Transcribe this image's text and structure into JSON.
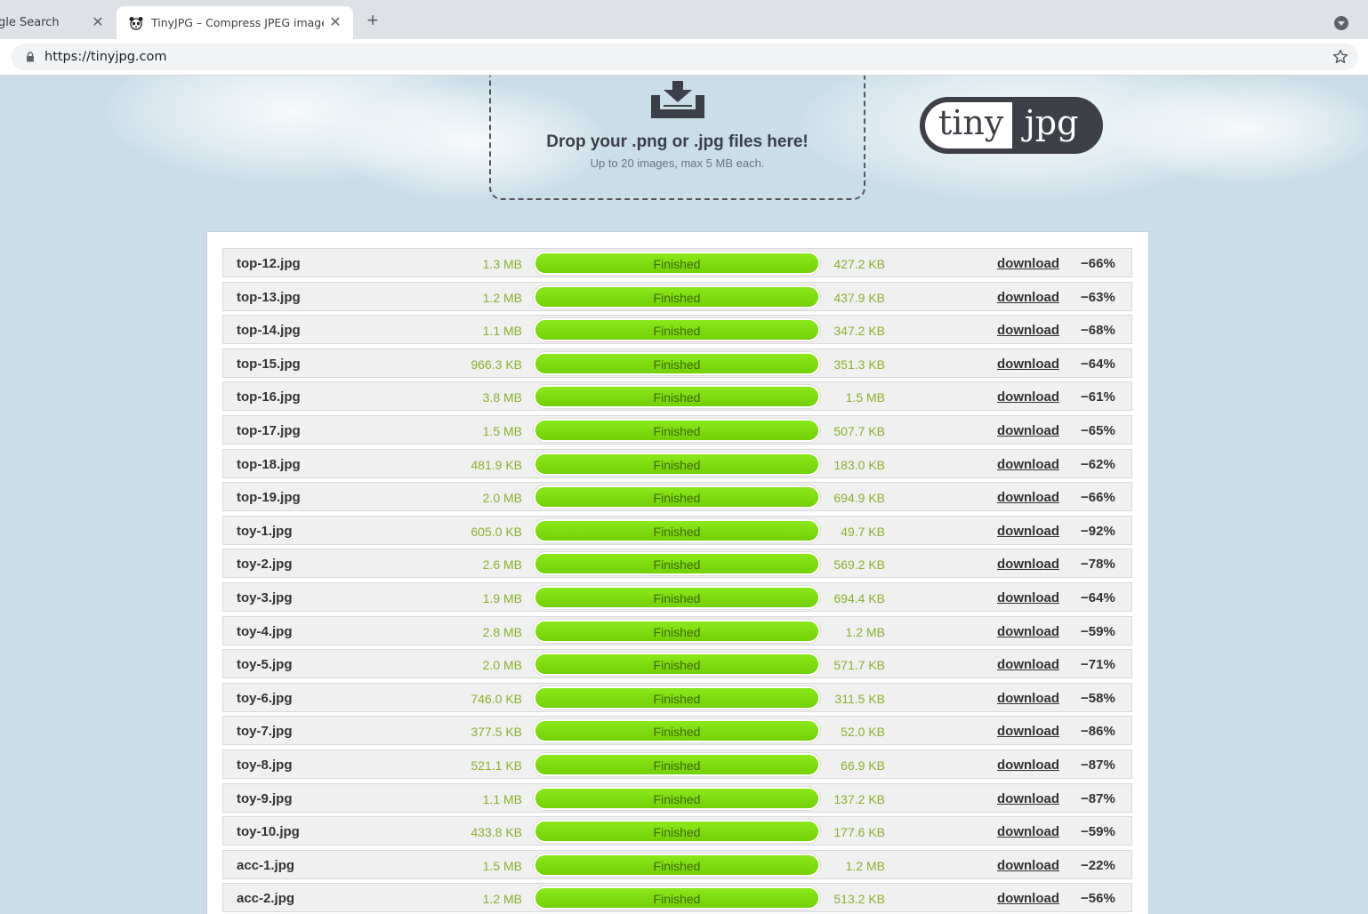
{
  "browser": {
    "tabs": [
      {
        "title": "gle Search"
      },
      {
        "title": "TinyJPG – Compress JPEG images"
      }
    ],
    "url": "https://tinyjpg.com"
  },
  "dropzone": {
    "title": "Drop your .png or .jpg files here!",
    "subtitle": "Up to 20 images, max 5 MB each."
  },
  "logo": {
    "left": "tiny",
    "right": "jpg"
  },
  "colors": {
    "progress": "#7ed90f",
    "size_text": "#8ab02a",
    "background": "#c9dee7"
  },
  "files": [
    {
      "name": "top-12.jpg",
      "original": "1.3 MB",
      "status": "Finished",
      "progress": 100,
      "compressed": "427.2 KB",
      "action": "download",
      "saving": "−66%"
    },
    {
      "name": "top-13.jpg",
      "original": "1.2 MB",
      "status": "Finished",
      "progress": 100,
      "compressed": "437.9 KB",
      "action": "download",
      "saving": "−63%"
    },
    {
      "name": "top-14.jpg",
      "original": "1.1 MB",
      "status": "Finished",
      "progress": 100,
      "compressed": "347.2 KB",
      "action": "download",
      "saving": "−68%"
    },
    {
      "name": "top-15.jpg",
      "original": "966.3 KB",
      "status": "Finished",
      "progress": 100,
      "compressed": "351.3 KB",
      "action": "download",
      "saving": "−64%"
    },
    {
      "name": "top-16.jpg",
      "original": "3.8 MB",
      "status": "Finished",
      "progress": 100,
      "compressed": "1.5 MB",
      "action": "download",
      "saving": "−61%"
    },
    {
      "name": "top-17.jpg",
      "original": "1.5 MB",
      "status": "Finished",
      "progress": 100,
      "compressed": "507.7 KB",
      "action": "download",
      "saving": "−65%"
    },
    {
      "name": "top-18.jpg",
      "original": "481.9 KB",
      "status": "Finished",
      "progress": 100,
      "compressed": "183.0 KB",
      "action": "download",
      "saving": "−62%"
    },
    {
      "name": "top-19.jpg",
      "original": "2.0 MB",
      "status": "Finished",
      "progress": 100,
      "compressed": "694.9 KB",
      "action": "download",
      "saving": "−66%"
    },
    {
      "name": "toy-1.jpg",
      "original": "605.0 KB",
      "status": "Finished",
      "progress": 100,
      "compressed": "49.7 KB",
      "action": "download",
      "saving": "−92%"
    },
    {
      "name": "toy-2.jpg",
      "original": "2.6 MB",
      "status": "Finished",
      "progress": 100,
      "compressed": "569.2 KB",
      "action": "download",
      "saving": "−78%"
    },
    {
      "name": "toy-3.jpg",
      "original": "1.9 MB",
      "status": "Finished",
      "progress": 100,
      "compressed": "694.4 KB",
      "action": "download",
      "saving": "−64%"
    },
    {
      "name": "toy-4.jpg",
      "original": "2.8 MB",
      "status": "Finished",
      "progress": 100,
      "compressed": "1.2 MB",
      "action": "download",
      "saving": "−59%"
    },
    {
      "name": "toy-5.jpg",
      "original": "2.0 MB",
      "status": "Finished",
      "progress": 100,
      "compressed": "571.7 KB",
      "action": "download",
      "saving": "−71%"
    },
    {
      "name": "toy-6.jpg",
      "original": "746.0 KB",
      "status": "Finished",
      "progress": 100,
      "compressed": "311.5 KB",
      "action": "download",
      "saving": "−58%"
    },
    {
      "name": "toy-7.jpg",
      "original": "377.5 KB",
      "status": "Finished",
      "progress": 100,
      "compressed": "52.0 KB",
      "action": "download",
      "saving": "−86%"
    },
    {
      "name": "toy-8.jpg",
      "original": "521.1 KB",
      "status": "Finished",
      "progress": 100,
      "compressed": "66.9 KB",
      "action": "download",
      "saving": "−87%"
    },
    {
      "name": "toy-9.jpg",
      "original": "1.1 MB",
      "status": "Finished",
      "progress": 100,
      "compressed": "137.2 KB",
      "action": "download",
      "saving": "−87%"
    },
    {
      "name": "toy-10.jpg",
      "original": "433.8 KB",
      "status": "Finished",
      "progress": 100,
      "compressed": "177.6 KB",
      "action": "download",
      "saving": "−59%"
    },
    {
      "name": "acc-1.jpg",
      "original": "1.5 MB",
      "status": "Finished",
      "progress": 100,
      "compressed": "1.2 MB",
      "action": "download",
      "saving": "−22%"
    },
    {
      "name": "acc-2.jpg",
      "original": "1.2 MB",
      "status": "Finished",
      "progress": 100,
      "compressed": "513.2 KB",
      "action": "download",
      "saving": "−56%"
    }
  ]
}
